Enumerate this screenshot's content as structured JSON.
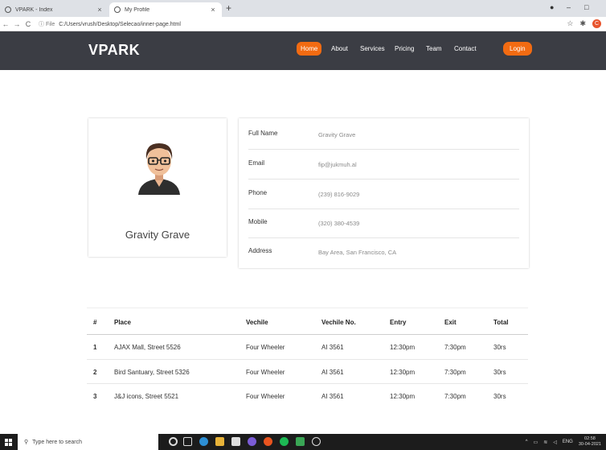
{
  "browser": {
    "tabs": [
      {
        "label": "VPARK - Index",
        "close": "×"
      },
      {
        "label": "My Profile",
        "close": "×"
      }
    ],
    "new_tab": "+",
    "nav": {
      "back": "←",
      "forward": "→",
      "reload": "C"
    },
    "url_info": "ⓘ File",
    "url": "C:/Users/vrush/Desktop/Selecao/inner-page.html",
    "profile_initial": "C",
    "window_controls": {
      "minimize": "–",
      "maximize": "□"
    }
  },
  "header": {
    "brand": "VPARK",
    "nav": [
      "Home",
      "About",
      "Services",
      "Pricing",
      "Team",
      "Contact"
    ],
    "active": "Home",
    "login": "Login",
    "accent_color": "#f26b12",
    "bg_color": "#3b3d44"
  },
  "profile": {
    "name": "Gravity Grave"
  },
  "details": [
    {
      "label": "Full Name",
      "value": "Gravity Grave"
    },
    {
      "label": "Email",
      "value": "fip@jukmuh.al"
    },
    {
      "label": "Phone",
      "value": "(239) 816-9029"
    },
    {
      "label": "Mobile",
      "value": "(320) 380-4539"
    },
    {
      "label": "Address",
      "value": "Bay Area, San Francisco, CA"
    }
  ],
  "table": {
    "headers": [
      "#",
      "Place",
      "Vechile",
      "Vechile No.",
      "Entry",
      "Exit",
      "Total"
    ],
    "rows": [
      [
        "1",
        "AJAX Mall, Street 5526",
        "Four Wheeler",
        "AI 3561",
        "12:30pm",
        "7:30pm",
        "30rs"
      ],
      [
        "2",
        "Bird Santuary, Street 5326",
        "Four Wheeler",
        "AI 3561",
        "12:30pm",
        "7:30pm",
        "30rs"
      ],
      [
        "3",
        "J&J icons, Street 5521",
        "Four Wheeler",
        "AI 3561",
        "12:30pm",
        "7:30pm",
        "30rs"
      ]
    ]
  },
  "taskbar": {
    "search_placeholder": "Type here to search",
    "tray_lang": "ENG",
    "time": "02:58",
    "date": "30-04-2021"
  }
}
